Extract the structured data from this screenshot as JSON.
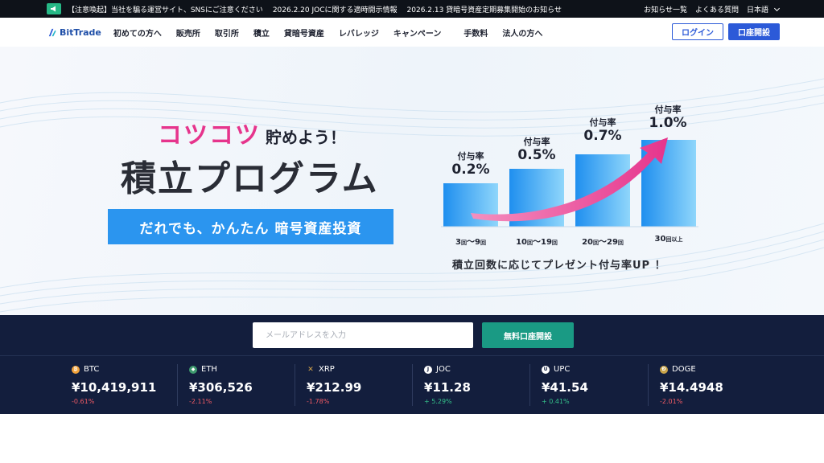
{
  "notice": {
    "items": [
      "【注意喚起】当社を騙る運営サイト、SNSにご注意ください",
      "2026.2.20 JOCに関する適時開示情報",
      "2026.2.13 貸暗号資産定期募集開始のお知らせ"
    ],
    "links": [
      "お知らせ一覧",
      "よくある質問"
    ],
    "language": "日本語"
  },
  "header": {
    "logo_text": "BitTrade",
    "nav": [
      "初めての方へ",
      "販売所",
      "取引所",
      "積立",
      "貸暗号資産",
      "レバレッジ",
      "キャンペーン",
      "手数料",
      "法人の方へ"
    ],
    "login_label": "ログイン",
    "open_account_label": "口座開設"
  },
  "hero": {
    "kotsu": "コツコツ",
    "kotsu_rest": "貯めよう！",
    "title": "積立プログラム",
    "pill": "だれでも、かんたん 暗号資産投資",
    "bar_label_word": "付与率",
    "rates": [
      "0.2%",
      "0.5%",
      "0.7%",
      "1.0%"
    ],
    "rate_values": [
      0.2,
      0.5,
      0.7,
      1.0
    ],
    "ranges": [
      {
        "main": "3",
        "unit": "回",
        "sep": "〜",
        "end": "9",
        "end_unit": "回",
        "suffix": ""
      },
      {
        "main": "10",
        "unit": "回",
        "sep": "〜",
        "end": "19",
        "end_unit": "回",
        "suffix": ""
      },
      {
        "main": "20",
        "unit": "回",
        "sep": "〜",
        "end": "29",
        "end_unit": "回",
        "suffix": ""
      },
      {
        "main": "30",
        "unit": "回以上",
        "sep": "",
        "end": "",
        "end_unit": "",
        "suffix": ""
      }
    ],
    "caption": "積立回数に応じてプレゼント付与率UP ！",
    "colors": {
      "pink": "#e6348c",
      "blue": "#2b95ef"
    }
  },
  "signup": {
    "email_placeholder": "メールアドレスを入力",
    "button_label": "無料口座開設"
  },
  "ticker": [
    {
      "symbol": "BTC",
      "price": "¥10,419,911",
      "change": "-0.61%",
      "dir": "neg",
      "icon": "bitcoin-icon",
      "color": "#f2a23a",
      "glyph": "₿"
    },
    {
      "symbol": "ETH",
      "price": "¥306,526",
      "change": "-2.11%",
      "dir": "neg",
      "icon": "ethereum-icon",
      "color": "#3e9a6e",
      "glyph": "◆"
    },
    {
      "symbol": "XRP",
      "price": "¥212.99",
      "change": "-1.78%",
      "dir": "neg",
      "icon": "xrp-icon",
      "color": "#131e3d",
      "glyph": "✕"
    },
    {
      "symbol": "JOC",
      "price": "¥11.28",
      "change": "+ 5.29%",
      "dir": "pos",
      "icon": "joc-icon",
      "color": "#ffffff",
      "glyph": "J"
    },
    {
      "symbol": "UPC",
      "price": "¥41.54",
      "change": "+ 0.41%",
      "dir": "pos",
      "icon": "upc-icon",
      "color": "#ffffff",
      "glyph": "U"
    },
    {
      "symbol": "DOGE",
      "price": "¥14.4948",
      "change": "-2.01%",
      "dir": "neg",
      "icon": "dogecoin-icon",
      "color": "#c9a44a",
      "glyph": "Ð"
    }
  ]
}
